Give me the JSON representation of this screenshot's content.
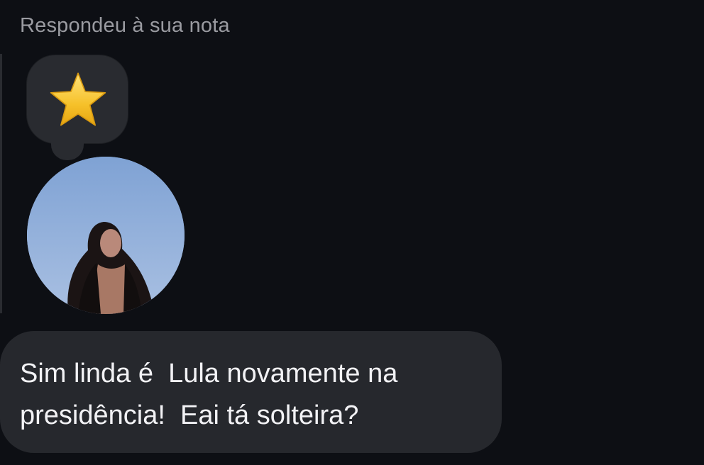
{
  "reply_caption": "Respondeu à sua nota",
  "note": {
    "emoji": "⭐",
    "icon": "star-icon"
  },
  "message": {
    "text": "Sim linda é  Lula novamente na\npresidência!  Eai tá solteira?"
  },
  "colors": {
    "background": "#0d0f14",
    "bubble": "#26282d",
    "note_bubble": "#292b30",
    "caption_text": "#9a9ba1",
    "message_text": "#f2f2f5",
    "star": "#f6c12a"
  }
}
